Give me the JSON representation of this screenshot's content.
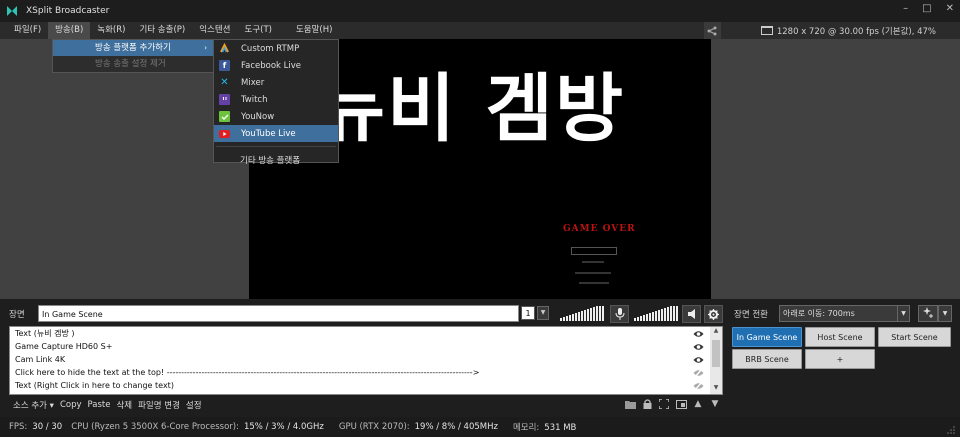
{
  "window": {
    "title": "XSplit Broadcaster",
    "minimize": "–",
    "maximize": "□",
    "close": "✕"
  },
  "menubar": {
    "items": [
      {
        "label": "파일(F)"
      },
      {
        "label": "방송(B)"
      },
      {
        "label": "녹화(R)"
      },
      {
        "label": "기타 송출(P)"
      },
      {
        "label": "익스텐션"
      },
      {
        "label": "도구(T)"
      },
      {
        "label": "도움말(H)"
      }
    ],
    "resolution": "1280 x 720 @ 30.00 fps (기본값), 47%"
  },
  "broadcast_menu": {
    "items": [
      {
        "label": "방송 플랫폼 추가하기",
        "arrow": "›"
      },
      {
        "label": "방송 송출 설정 제거"
      }
    ]
  },
  "platform_menu": {
    "items": [
      {
        "label": "Custom RTMP"
      },
      {
        "label": "Facebook Live"
      },
      {
        "label": "Mixer"
      },
      {
        "label": "Twitch"
      },
      {
        "label": "YouNow"
      },
      {
        "label": "YouTube Live"
      }
    ],
    "other": "기타 방송 플랫폼"
  },
  "preview": {
    "big_text": "뉴비 겜방",
    "game_over": "GAME OVER"
  },
  "scene_bar": {
    "scene_label": "장면",
    "scene_name": "In Game Scene",
    "scene_number": "1",
    "transition_label": "장면 전환",
    "transition_value": "아래로 이동: 700ms",
    "dropdown": "▼"
  },
  "sources": {
    "rows": [
      {
        "label": "Text (뉴비 겜방 )",
        "visible": true
      },
      {
        "label": "Game Capture HD60 S+",
        "visible": true
      },
      {
        "label": "Cam Link 4K",
        "visible": true
      },
      {
        "label": "Click here to hide the text at the top! ---------------------------------------------------------------------------------------------------------->",
        "visible": false
      },
      {
        "label": "Text (Right Click in here to change text)",
        "visible": false
      }
    ]
  },
  "source_toolbar": {
    "add": "소스 추가 ▾",
    "copy": "Copy",
    "paste": "Paste",
    "delete": "삭제",
    "rename": "파일명 변경",
    "settings": "설정"
  },
  "scene_buttons": {
    "in_game": "In Game Scene",
    "host": "Host Scene",
    "start": "Start Scene",
    "brb": "BRB Scene",
    "add": "+"
  },
  "status": {
    "fps_label": "FPS:",
    "fps_value": "30 / 30",
    "cpu_label": "CPU (Ryzen 5 3500X 6-Core Processor):",
    "cpu_value": "15% / 3% / 4.0GHz",
    "gpu_label": "GPU (RTX 2070):",
    "gpu_value": "19% / 8% / 405MHz",
    "mem_label": "메모리:",
    "mem_value": "531 MB"
  },
  "colors": {
    "accent": "#3f6f9c",
    "active_scene": "#1f6fb2",
    "youtube": "#e02020",
    "twitch": "#6441a4",
    "facebook": "#3b5998",
    "younow": "#6bc33e",
    "mixer": "#1fbaed"
  }
}
